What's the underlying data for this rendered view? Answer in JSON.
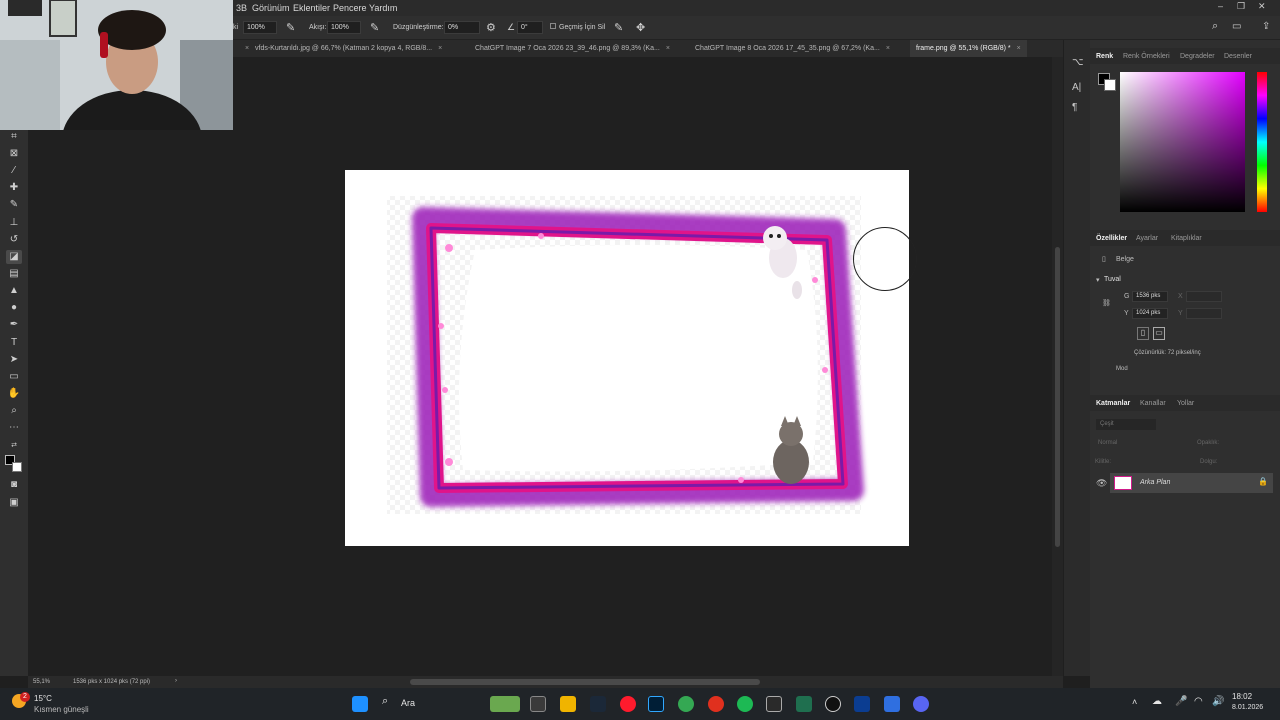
{
  "menu": {
    "items": [
      "3B",
      "Görünüm",
      "Eklentiler",
      "Pencere",
      "Yardım"
    ]
  },
  "options": {
    "opacity_label": "ki",
    "opacity_value": "100%",
    "flow_label": "Akışı:",
    "flow_value": "100%",
    "smoothing_label": "Düzgünleştirme:",
    "smoothing_value": "0%",
    "angle_value": "0°",
    "history_label": "Geçmiş İçin Sil"
  },
  "tabs": [
    {
      "label": "vfds-Kurtarıldı.jpg @ 66,7% (Katman 2 kopya 4, RGB/8...",
      "active": false
    },
    {
      "label": "ChatGPT Image 7 Oca 2026 23_39_46.png @ 89,3% (Ka...",
      "active": false
    },
    {
      "label": "ChatGPT Image 8 Oca 2026 17_45_35.png @ 67,2% (Ka...",
      "active": false
    },
    {
      "label": "frame.png @ 55,1% (RGB/8) *",
      "active": true
    }
  ],
  "status": {
    "zoom": "55,1%",
    "doc_size": "1536 pks x 1024 pks (72 ppi)"
  },
  "color_panel": {
    "tabs": [
      "Renk",
      "Renk Örnekleri",
      "Degradeler",
      "Desenler"
    ],
    "foreground": "#000000",
    "background": "#ffffff",
    "hue": "#e200ff"
  },
  "properties_panel": {
    "tabs": [
      "Özellikler",
      "Ayarlar",
      "Kitaplıklar"
    ],
    "doc_label": "Belge",
    "section": "Tuval",
    "w_label": "G",
    "w_value": "1536 pks",
    "h_label": "Y",
    "h_value": "1024 pks",
    "x_label": "X",
    "y_label": "Y",
    "resolution": "Çözünürlük: 72 piksel/inç",
    "mode_label": "Mod"
  },
  "layers_panel": {
    "tabs": [
      "Katmanlar",
      "Kanallar",
      "Yollar"
    ],
    "search_placeholder": "Çeşit",
    "blend_mode": "Normal",
    "opacity_label": "Opaklık:",
    "lock_label": "Kilitle:",
    "fill_label": "Dolgu:",
    "layer_name": "Arka Plan"
  },
  "taskbar": {
    "weather_temp": "15°C",
    "weather_desc": "Kısmen güneşli",
    "notification_count": "2",
    "search_label": "Ara",
    "time": "18:02",
    "date": "8.01.2026"
  }
}
